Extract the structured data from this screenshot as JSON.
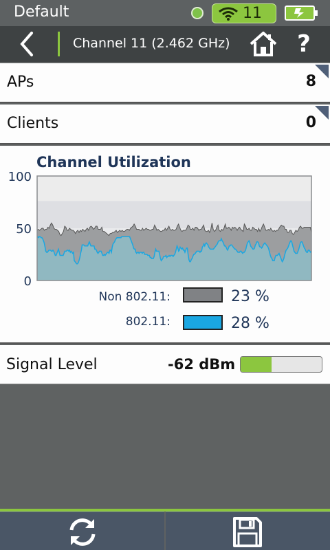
{
  "status": {
    "title": "Default",
    "wifi_channel": "11"
  },
  "nav": {
    "title": "Channel 11 (2.462 GHz)"
  },
  "aps": {
    "label": "APs",
    "value": "8"
  },
  "clients": {
    "label": "Clients",
    "value": "0"
  },
  "utilization": {
    "title": "Channel Utilization",
    "legend": [
      {
        "label": "Non 802.11:",
        "value": "23 %",
        "color": "#808285"
      },
      {
        "label": "802.11:",
        "value": "28 %",
        "color": "#1aa7e2"
      }
    ]
  },
  "chart_data": {
    "type": "area",
    "title": "Channel Utilization",
    "ylim": [
      0,
      100
    ],
    "yticks": [
      "100",
      "50",
      "0"
    ],
    "bands": [
      {
        "from": 76,
        "to": 100,
        "color": "#ececec"
      },
      {
        "from": 50,
        "to": 76,
        "color": "#dedfe3"
      },
      {
        "from": 27,
        "to": 50,
        "color": "#e9eaec"
      }
    ],
    "series": [
      {
        "name": "Non 802.11",
        "color": "#8e9093",
        "values": [
          48,
          49,
          48,
          49,
          50,
          50,
          48,
          49,
          49,
          51,
          50,
          53,
          55,
          53,
          50,
          49,
          49,
          48,
          47,
          44,
          43,
          45,
          47,
          52,
          51,
          48,
          48,
          50,
          49,
          48,
          48,
          47,
          45,
          47,
          48,
          46,
          48,
          47,
          49,
          48,
          47,
          49,
          50,
          48,
          51,
          52,
          51,
          49,
          50,
          52,
          52,
          49,
          49,
          49,
          51,
          47,
          47,
          46,
          45,
          44,
          43,
          45,
          45,
          46,
          46,
          47,
          48,
          46,
          47,
          48,
          47,
          48,
          47,
          47,
          48,
          49,
          49,
          48,
          50,
          51,
          52,
          54,
          52,
          49,
          49,
          49,
          48,
          48,
          50,
          48,
          49,
          50,
          49,
          49,
          48,
          48,
          49,
          49,
          53,
          51,
          48,
          49,
          48,
          47,
          47,
          48,
          48,
          50,
          48,
          50,
          52,
          49,
          48,
          49,
          48,
          48,
          49,
          52,
          54,
          51,
          48,
          47,
          48,
          48,
          48,
          50,
          53,
          52,
          49,
          49,
          50,
          48,
          51,
          51,
          50,
          48,
          49,
          49,
          51,
          53,
          48,
          47,
          47,
          48,
          46,
          49,
          55,
          49,
          47,
          48,
          51,
          53,
          48,
          47,
          49,
          48,
          50,
          54,
          50,
          50,
          51,
          50,
          48,
          51,
          50,
          51,
          50,
          48,
          50,
          51,
          49,
          48,
          47,
          54,
          52,
          49,
          49,
          50,
          48,
          48,
          51,
          50,
          49,
          49,
          47,
          50,
          47,
          49,
          52,
          54,
          51,
          48,
          48,
          49,
          48,
          50,
          48,
          47,
          48,
          47,
          48,
          48,
          50,
          52,
          53,
          52,
          52,
          49,
          49,
          46,
          46,
          48,
          48,
          45,
          44,
          46,
          48,
          47,
          48,
          51,
          52,
          50,
          50,
          51,
          51,
          51,
          51,
          51,
          51,
          46
        ]
      },
      {
        "name": "802.11",
        "color": "#1aa7e2",
        "values": [
          41,
          42,
          41,
          42,
          42,
          41,
          41,
          40,
          38,
          36,
          32,
          28,
          27,
          27,
          28,
          29,
          29,
          29,
          28,
          28,
          29,
          28,
          26,
          24,
          24,
          26,
          28,
          30,
          27,
          24,
          24,
          24,
          24,
          24,
          26,
          28,
          28,
          28,
          29,
          29,
          28,
          29,
          27,
          28,
          27,
          26,
          27,
          19,
          18,
          17,
          16,
          16,
          17,
          19,
          22,
          26,
          29,
          34,
          34,
          34,
          33,
          33,
          33,
          33,
          33,
          35,
          37,
          35,
          33,
          33,
          33,
          33,
          33,
          30,
          30,
          29,
          27,
          26,
          27,
          28,
          28,
          28,
          26,
          24,
          24,
          25,
          24,
          25,
          26,
          27,
          27,
          26,
          29,
          29,
          27,
          32,
          35,
          36,
          37,
          39,
          40,
          41,
          41,
          41,
          41,
          41,
          41,
          42,
          42,
          42,
          42,
          42,
          42,
          42,
          42,
          42,
          42,
          42,
          40,
          38,
          36,
          34,
          31,
          30,
          30,
          27,
          26,
          27,
          27,
          26,
          27,
          27,
          27,
          26,
          27,
          27,
          25,
          25,
          25,
          25,
          24,
          24,
          24,
          22,
          22,
          21,
          21,
          21,
          23,
          27,
          30,
          28,
          28,
          28,
          28,
          25,
          21,
          19,
          20,
          21,
          23,
          23,
          23,
          24,
          22,
          23,
          23,
          24,
          23,
          24,
          24,
          24,
          23,
          24,
          25,
          27,
          30,
          33,
          31,
          28,
          29,
          32,
          31,
          30,
          31,
          29,
          29,
          27,
          29,
          31,
          31,
          25,
          20,
          18,
          18,
          20,
          21,
          23,
          25,
          25,
          26,
          27,
          28,
          28,
          28,
          28,
          27,
          28,
          28,
          32,
          33,
          35,
          33,
          35,
          36,
          35,
          34,
          32,
          31,
          30,
          30,
          30,
          30,
          30,
          31,
          32,
          33,
          34,
          35,
          37,
          38,
          38,
          38,
          40,
          38,
          37,
          35,
          33,
          33,
          32,
          30,
          29,
          31,
          33,
          33,
          34,
          34,
          33,
          32,
          31,
          30,
          30,
          29,
          28,
          27,
          27,
          27,
          28,
          28,
          27,
          26,
          27,
          27,
          28,
          30,
          33,
          36,
          37,
          38,
          36,
          33,
          32,
          31,
          30,
          30,
          31,
          34,
          35,
          37,
          37,
          36,
          33,
          32,
          32,
          31,
          32,
          34,
          35,
          36,
          35,
          34,
          33,
          32,
          30,
          27,
          24,
          22,
          21,
          19,
          19,
          19,
          22,
          24,
          24,
          24,
          25,
          26,
          24,
          22,
          20,
          18,
          19,
          21,
          24,
          27,
          29,
          30,
          31,
          33,
          35,
          37,
          38,
          37,
          34,
          31,
          28,
          27,
          26,
          26,
          26,
          28,
          30,
          33,
          36,
          37,
          37,
          35,
          33,
          31,
          30,
          28,
          27,
          27,
          29,
          29,
          28,
          27,
          28
        ]
      }
    ]
  },
  "signal": {
    "label": "Signal Level",
    "value": "-62 dBm",
    "fill_fraction": 0.38
  }
}
